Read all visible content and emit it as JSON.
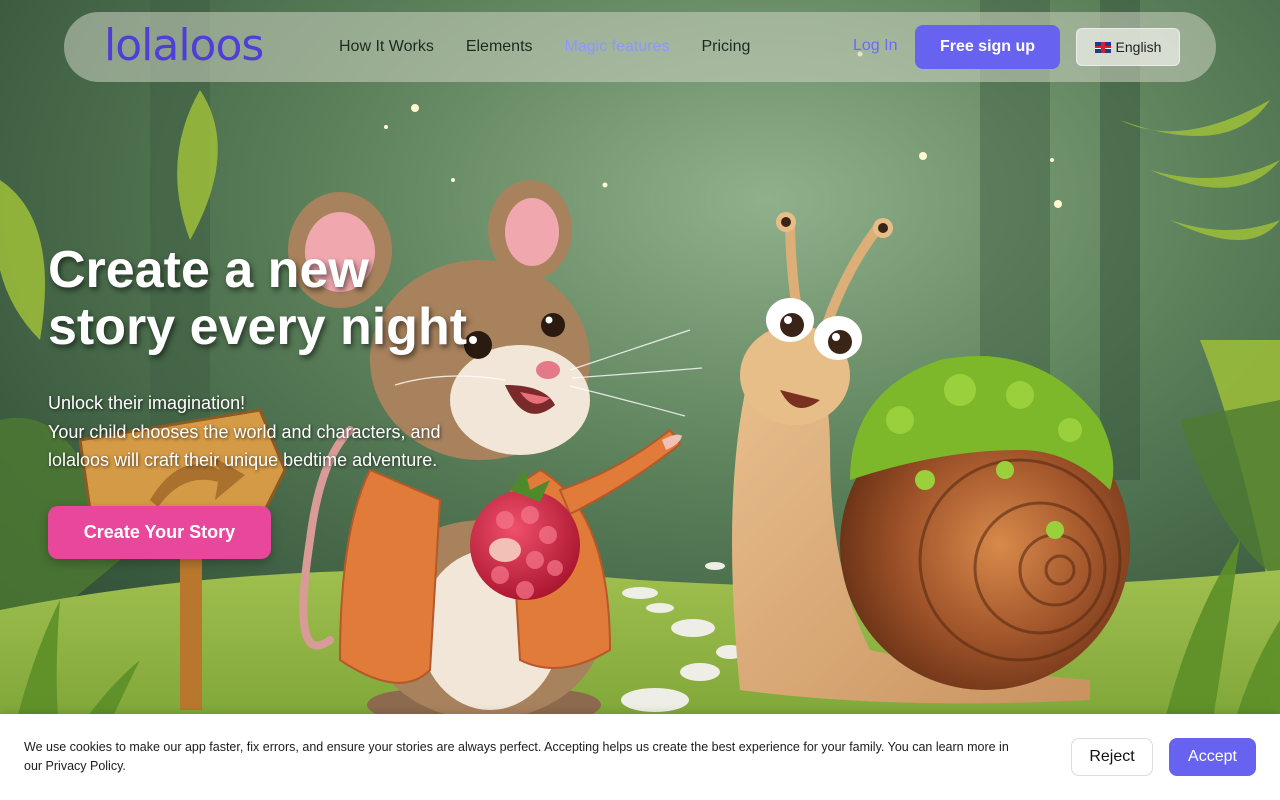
{
  "brand": {
    "logo_text": "lolaloos",
    "accent": "#6763f0",
    "cta_color": "#e8479b"
  },
  "nav": {
    "links": [
      {
        "label": "How It Works",
        "active": false
      },
      {
        "label": "Elements",
        "active": false
      },
      {
        "label": "Magic features",
        "active": true
      },
      {
        "label": "Pricing",
        "active": false
      }
    ],
    "login": "Log In",
    "signup": "Free sign up",
    "language": "English",
    "language_icon": "uk-flag-icon"
  },
  "hero": {
    "title_line1": "Create a new",
    "title_line2": "story every night",
    "subtitle_line1": "Unlock their imagination!",
    "subtitle_line2": "Your child chooses the world and characters, and lolaloos will craft their unique bedtime adventure.",
    "cta": "Create Your Story",
    "illustration": "mouse-holding-raspberry-and-snail-in-forest"
  },
  "cookie": {
    "text": "We use cookies to make our app faster, fix errors, and ensure your stories are always perfect. Accepting helps us create the best experience for your family. You can learn more in our Privacy Policy.",
    "reject": "Reject",
    "accept": "Accept"
  }
}
